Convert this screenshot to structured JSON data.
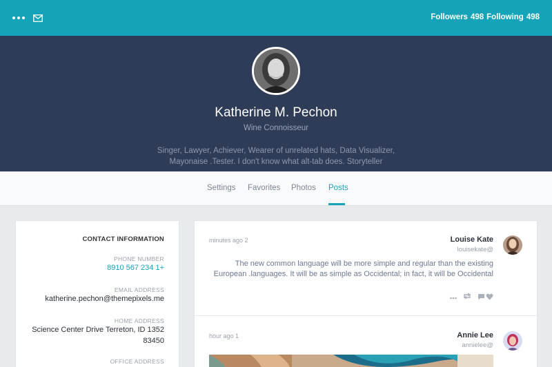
{
  "topbar": {
    "followers_label": "Followers",
    "followers_count": "498",
    "following_label": "Following",
    "following_count": "498",
    "icons": [
      "more-dots-icon",
      "mail-icon"
    ]
  },
  "profile": {
    "name": "Katherine M. Pechon",
    "role": "Wine Connoisseur",
    "bio": "Singer, Lawyer, Achiever, Wearer of unrelated hats, Data Visualizer, Mayonaise .Tester. I don't know what alt-tab does. Storyteller",
    "socials": [
      "instagram-icon",
      "pinterest-icon",
      "twitter-icon",
      "facebook-icon"
    ]
  },
  "tabs": [
    {
      "label": "Settings"
    },
    {
      "label": "Favorites"
    },
    {
      "label": "Photos"
    },
    {
      "label": "Posts",
      "active": true
    }
  ],
  "contact": {
    "title": "CONTACT INFORMATION",
    "phone_label": "PHONE NUMBER",
    "phone": "8910 567 234 1+",
    "email_label": "EMAIL ADDRESS",
    "email": "katherine.pechon@themepixels.me",
    "home_label": "HOME ADDRESS",
    "home_line1": "Science Center Drive Terreton, ID 1352",
    "home_line2": "83450",
    "office_label": "OFFICE ADDRESS"
  },
  "posts": [
    {
      "time": "minutes ago 2",
      "author": "Louise Kate",
      "handle": "louisekate@",
      "text": "The new common language will be more simple and regular than the existing European .languages. It will be as simple as Occidental; in fact, it will be Occidental"
    },
    {
      "time": "hour ago 1",
      "author": "Annie Lee",
      "handle": "annielee@"
    }
  ],
  "colors": {
    "accent": "#14a3b8",
    "hero_bg": "#2e3c58",
    "page_bg": "#e8ebee"
  }
}
